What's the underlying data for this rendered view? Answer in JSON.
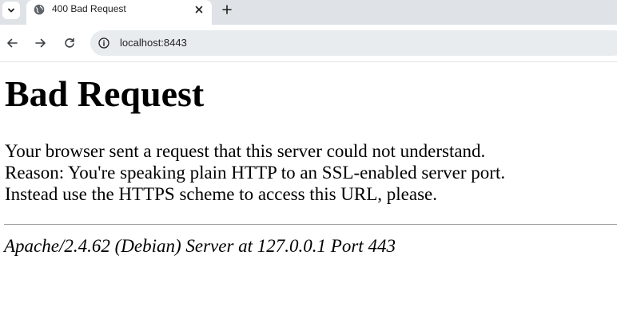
{
  "browser": {
    "tab": {
      "title": "400 Bad Request"
    },
    "new_tab_label": "+",
    "address_bar": {
      "url": "localhost:8443"
    }
  },
  "page": {
    "title": "Bad Request",
    "message_lines": [
      "Your browser sent a request that this server could not understand.",
      "Reason: You're speaking plain HTTP to an SSL-enabled server port.",
      "Instead use the HTTPS scheme to access this URL, please."
    ],
    "server_signature": "Apache/2.4.62 (Debian) Server at 127.0.0.1 Port 443"
  }
}
